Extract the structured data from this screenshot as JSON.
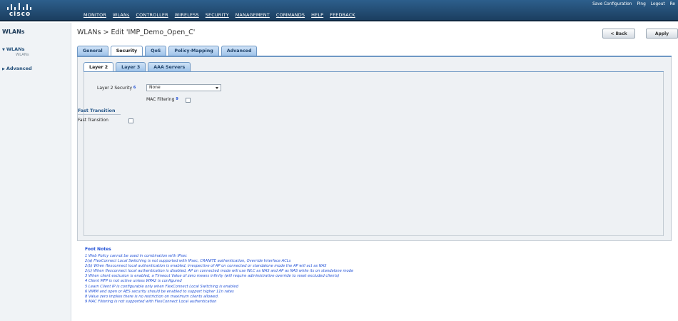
{
  "brand": {
    "logo_text": "cisco"
  },
  "top_nav": [
    "MONITOR",
    "WLANs",
    "CONTROLLER",
    "WIRELESS",
    "SECURITY",
    "MANAGEMENT",
    "COMMANDS",
    "HELP",
    "FEEDBACK"
  ],
  "top_links": {
    "save_config": "Save Configuration",
    "ping": "Ping",
    "logout": "Logout",
    "refresh": "Re"
  },
  "sidebar": {
    "title": "WLANs",
    "items": [
      {
        "label": "WLANs",
        "expanded": true,
        "sub": "WLANs"
      },
      {
        "label": "Advanced",
        "expanded": false
      }
    ]
  },
  "page": {
    "title": "WLANs > Edit  'IMP_Demo_Open_C'"
  },
  "buttons": {
    "back": "< Back",
    "apply": "Apply"
  },
  "tabs": [
    "General",
    "Security",
    "QoS",
    "Policy-Mapping",
    "Advanced"
  ],
  "active_tab": "Security",
  "subtabs": [
    "Layer 2",
    "Layer 3",
    "AAA Servers"
  ],
  "active_subtab": "Layer 2",
  "form": {
    "layer2_security_label": "Layer 2 Security",
    "layer2_security_ref": "6",
    "layer2_security_value": "None",
    "mac_filtering_label": "MAC Filtering",
    "mac_filtering_ref": "9",
    "mac_filtering_checked": false,
    "fast_transition_section": "Fast Transition",
    "fast_transition_label": "Fast Transition",
    "fast_transition_checked": false
  },
  "foot_notes": {
    "title": "Foot Notes",
    "items": [
      "1 Web Policy cannot be used in combination with IPsec",
      "2(a) FlexConnect Local Switching is not supported with IPsec, CRANITE authentication, Override Interface ACLs",
      "2(b) When flexconnect local authentication is enabled, irrespective of AP on connected or standalone mode the AP will act as NAS",
      "2(c) When flexconnect local authentication is disabled, AP on connected mode will use WLC as NAS and AP as NAS while its on standalone mode",
      "3 When client exclusion is enabled, a Timeout Value of zero means infinity (will require administrative override to reset excluded clients)",
      "4 Client MFP is not active unless WPA2 is configured",
      "5 Learn Client IP is configurable only when FlexConnect Local Switching is enabled",
      "6 WMM and open or AES security should be enabled to support higher 11n rates",
      "8 Value zero implies there is no restriction on maximum clients allowed.",
      "9 MAC Filtering is not supported with FlexConnect Local authentication"
    ]
  },
  "colors": {
    "header_bg": "#2d5f8c",
    "tab_bg": "#9fc3ea",
    "note_blue": "#1f4fd6"
  }
}
